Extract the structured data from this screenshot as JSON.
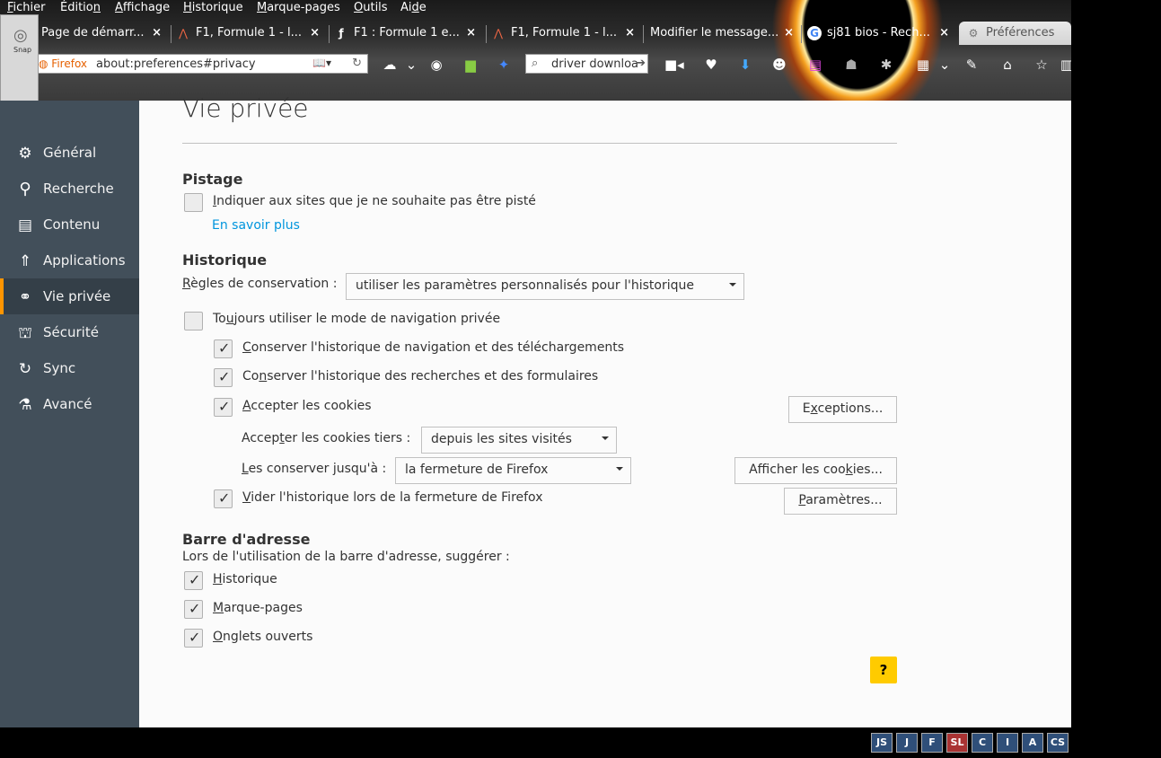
{
  "menubar": {
    "items": [
      {
        "pre": "",
        "u": "F",
        "post": "ichier"
      },
      {
        "pre": "Éditio",
        "u": "n",
        "post": ""
      },
      {
        "pre": "",
        "u": "A",
        "post": "ffichage"
      },
      {
        "pre": "",
        "u": "H",
        "post": "istorique"
      },
      {
        "pre": "",
        "u": "M",
        "post": "arque-pages"
      },
      {
        "pre": "",
        "u": "O",
        "post": "utils"
      },
      {
        "pre": "Ai",
        "u": "d",
        "post": "e"
      }
    ]
  },
  "tabs": [
    {
      "title": "Page de démarr...",
      "icon": "firefox-icon"
    },
    {
      "title": "F1, Formule 1 - l...",
      "icon": "f1-icon"
    },
    {
      "title": "F1 : Formule 1 e...",
      "icon": "f1-alt-icon"
    },
    {
      "title": "F1, Formule 1 - l...",
      "icon": "f1-icon"
    },
    {
      "title": "Modifier le message...",
      "icon": ""
    },
    {
      "title": "sj81 bios - Rech...",
      "icon": "google-icon"
    },
    {
      "title": "Préférences",
      "icon": "gear-icon"
    }
  ],
  "navbar": {
    "identity": "Firefox",
    "url": "about:preferences#privacy",
    "search_value": "driver downloa"
  },
  "snap": {
    "label": "Snap"
  },
  "sidebar": {
    "items": [
      {
        "label": "Général",
        "icon": "general-icon",
        "glyph": "⚙"
      },
      {
        "label": "Recherche",
        "icon": "search-icon",
        "glyph": "🔍"
      },
      {
        "label": "Contenu",
        "icon": "content-icon",
        "glyph": "▤"
      },
      {
        "label": "Applications",
        "icon": "applications-icon",
        "glyph": "🚀"
      },
      {
        "label": "Vie privée",
        "icon": "privacy-mask-icon",
        "glyph": "◉"
      },
      {
        "label": "Sécurité",
        "icon": "security-icon",
        "glyph": "🔒"
      },
      {
        "label": "Sync",
        "icon": "sync-icon",
        "glyph": "↻"
      },
      {
        "label": "Avancé",
        "icon": "advanced-icon",
        "glyph": "⚗"
      }
    ],
    "selected": "Vie privée"
  },
  "main": {
    "title": "Vie privée",
    "tracking": {
      "heading": "Pistage",
      "do_not_track": {
        "pre": "",
        "u": "I",
        "post": "ndiquer aux sites que je ne souhaite pas être pisté",
        "checked": false
      },
      "learn_more": "En savoir plus"
    },
    "history": {
      "heading": "Historique",
      "rules_label_pre": "",
      "rules_label_u": "R",
      "rules_label_post": "ègles de conservation :",
      "rules_value": "utiliser les paramètres personnalisés pour l'historique",
      "always_private": {
        "pre": "To",
        "u": "u",
        "post": "jours utiliser le mode de navigation privée",
        "checked": false
      },
      "keep_browsing": {
        "pre": "",
        "u": "C",
        "post": "onserver l'historique de navigation et des téléchargements",
        "checked": true
      },
      "keep_search": {
        "pre": "Co",
        "u": "n",
        "post": "server l'historique des recherches et des formulaires",
        "checked": true
      },
      "accept_cookies": {
        "pre": "",
        "u": "A",
        "post": "ccepter les cookies",
        "checked": true
      },
      "exceptions_button": {
        "pre": "E",
        "u": "x",
        "post": "ceptions..."
      },
      "third_party_label": {
        "pre": "Accep",
        "u": "t",
        "post": "er les cookies tiers :"
      },
      "third_party_value": "depuis les sites visités",
      "keep_until_label": {
        "pre": "",
        "u": "L",
        "post": "es conserver jusqu'à :"
      },
      "keep_until_value": "la fermeture de Firefox",
      "show_cookies_button": {
        "pre": "Afficher les coo",
        "u": "k",
        "post": "ies..."
      },
      "clear_on_close": {
        "pre": "",
        "u": "V",
        "post": "ider l'historique lors de la fermeture de Firefox",
        "checked": true
      },
      "settings_button": {
        "pre": "",
        "u": "P",
        "post": "aramètres..."
      }
    },
    "address_bar": {
      "heading": "Barre d'adresse",
      "description": "Lors de l'utilisation de la barre d'adresse, suggérer :",
      "history": {
        "pre": "",
        "u": "H",
        "post": "istorique",
        "checked": true
      },
      "bookmarks": {
        "pre": "",
        "u": "M",
        "post": "arque-pages",
        "checked": true
      },
      "open_tabs": {
        "pre": "",
        "u": "O",
        "post": "nglets ouverts",
        "checked": true
      }
    },
    "help_label": "?"
  },
  "status_badges": [
    "JS",
    "J",
    "F",
    "SL",
    "C",
    "I",
    "A",
    "CS"
  ],
  "colors": {
    "sidebar_bg": "#424f5a",
    "selected_accent": "#ff9500",
    "link": "#0095dd",
    "help_button": "#ffcb00"
  }
}
